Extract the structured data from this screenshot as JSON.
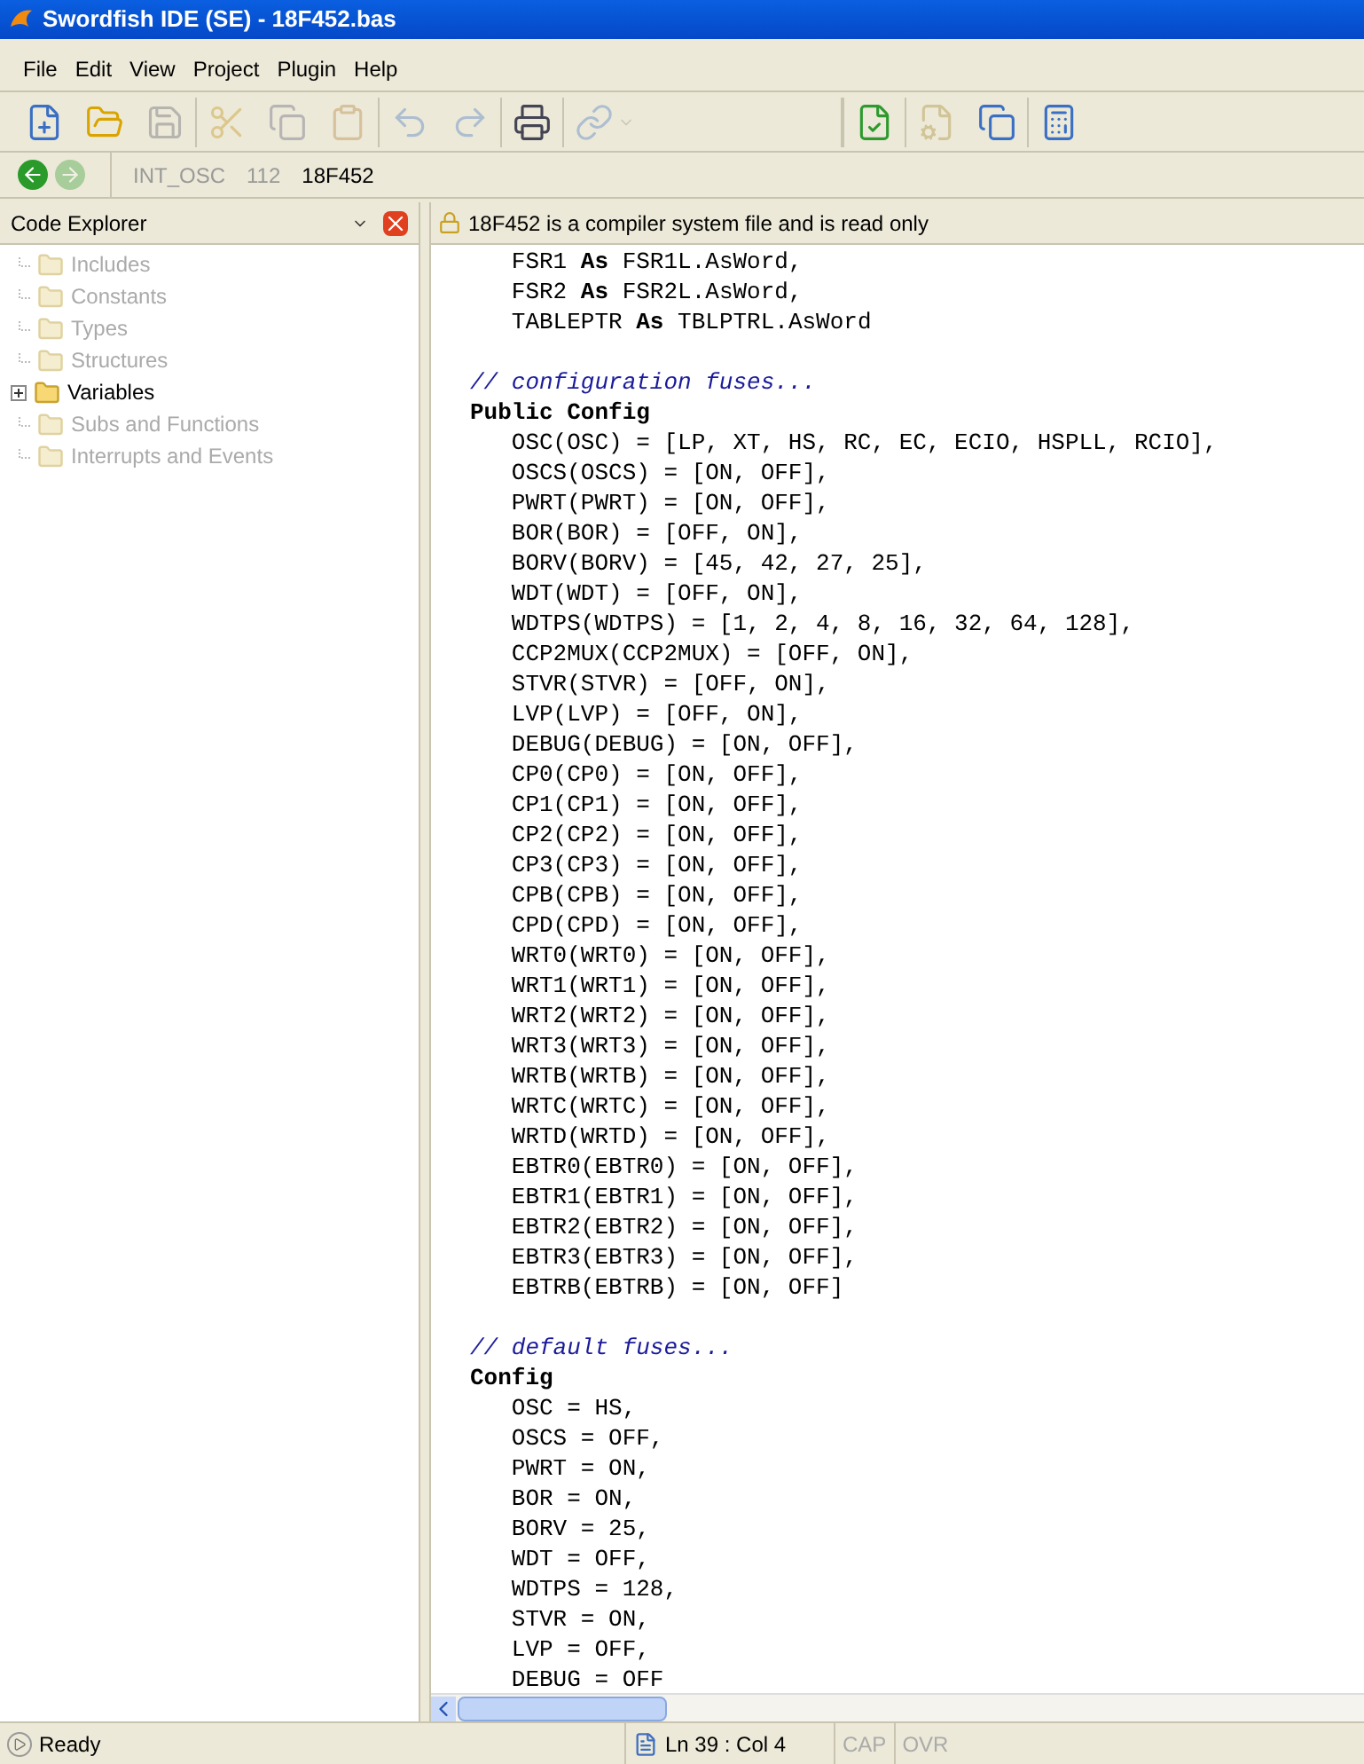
{
  "window": {
    "title": "Swordfish IDE (SE) - 18F452.bas"
  },
  "menu": [
    "File",
    "Edit",
    "View",
    "Project",
    "Plugin",
    "Help"
  ],
  "toolbar": [
    [
      {
        "kind": "new",
        "disabled": false
      },
      {
        "kind": "open",
        "disabled": false
      },
      {
        "kind": "save",
        "disabled": true
      }
    ],
    [
      {
        "kind": "cut",
        "disabled": true
      },
      {
        "kind": "copy",
        "disabled": true
      },
      {
        "kind": "paste",
        "disabled": true
      }
    ],
    [
      {
        "kind": "undo",
        "disabled": true
      },
      {
        "kind": "redo",
        "disabled": true
      }
    ],
    [
      {
        "kind": "print",
        "disabled": false
      }
    ],
    [
      {
        "kind": "link",
        "disabled": true
      }
    ],
    [
      {
        "kind": "compile",
        "disabled": false
      }
    ],
    [
      {
        "kind": "program",
        "disabled": true
      },
      {
        "kind": "windows",
        "disabled": false
      }
    ],
    [
      {
        "kind": "calculator",
        "disabled": false
      }
    ]
  ],
  "navigation": {
    "back_disabled": false,
    "forward_disabled": true,
    "crumbs": [
      {
        "text": "INT_OSC",
        "disabled": true
      },
      {
        "text": "112",
        "disabled": true
      },
      {
        "text": "18F452",
        "disabled": false
      }
    ]
  },
  "code_explorer": {
    "title": "Code Explorer",
    "items": [
      {
        "label": "Includes",
        "disabled": true,
        "expandable": false
      },
      {
        "label": "Constants",
        "disabled": true,
        "expandable": false
      },
      {
        "label": "Types",
        "disabled": true,
        "expandable": false
      },
      {
        "label": "Structures",
        "disabled": true,
        "expandable": false
      },
      {
        "label": "Variables",
        "disabled": false,
        "expandable": true
      },
      {
        "label": "Subs and Functions",
        "disabled": true,
        "expandable": false
      },
      {
        "label": "Interrupts and Events",
        "disabled": true,
        "expandable": false
      }
    ]
  },
  "editor": {
    "notice": "18F452 is a compiler system file and is read only",
    "blocks": [
      {
        "lines": [
          [
            {
              "kind": "plain",
              "text": "   FSR1 "
            },
            {
              "kind": "keyword",
              "text": "As"
            },
            {
              "kind": "plain",
              "text": " FSR1L.AsWord,"
            }
          ],
          [
            {
              "kind": "plain",
              "text": "   FSR2 "
            },
            {
              "kind": "keyword",
              "text": "As"
            },
            {
              "kind": "plain",
              "text": " FSR2L.AsWord,"
            }
          ],
          [
            {
              "kind": "plain",
              "text": "   TABLEPTR "
            },
            {
              "kind": "keyword",
              "text": "As"
            },
            {
              "kind": "plain",
              "text": " TBLPTRL.AsWord"
            }
          ]
        ]
      },
      {
        "lines": [
          [
            {
              "kind": "comment",
              "text": "// configuration fuses..."
            }
          ],
          [
            {
              "kind": "keyword",
              "text": "Public Config"
            }
          ],
          [
            {
              "kind": "plain",
              "text": "   OSC(OSC) = [LP, XT, HS, RC, EC, ECIO, HSPLL, RCIO],"
            }
          ],
          [
            {
              "kind": "plain",
              "text": "   OSCS(OSCS) = [ON, OFF],"
            }
          ],
          [
            {
              "kind": "plain",
              "text": "   PWRT(PWRT) = [ON, OFF],"
            }
          ],
          [
            {
              "kind": "plain",
              "text": "   BOR(BOR) = [OFF, ON],"
            }
          ],
          [
            {
              "kind": "plain",
              "text": "   BORV(BORV) = [45, 42, 27, 25],"
            }
          ],
          [
            {
              "kind": "plain",
              "text": "   WDT(WDT) = [OFF, ON],"
            }
          ],
          [
            {
              "kind": "plain",
              "text": "   WDTPS(WDTPS) = [1, 2, 4, 8, 16, 32, 64, 128],"
            }
          ],
          [
            {
              "kind": "plain",
              "text": "   CCP2MUX(CCP2MUX) = [OFF, ON],"
            }
          ],
          [
            {
              "kind": "plain",
              "text": "   STVR(STVR) = [OFF, ON],"
            }
          ],
          [
            {
              "kind": "plain",
              "text": "   LVP(LVP) = [OFF, ON],"
            }
          ],
          [
            {
              "kind": "plain",
              "text": "   DEBUG(DEBUG) = [ON, OFF],"
            }
          ],
          [
            {
              "kind": "plain",
              "text": "   CP0(CP0) = [ON, OFF],"
            }
          ],
          [
            {
              "kind": "plain",
              "text": "   CP1(CP1) = [ON, OFF],"
            }
          ],
          [
            {
              "kind": "plain",
              "text": "   CP2(CP2) = [ON, OFF],"
            }
          ],
          [
            {
              "kind": "plain",
              "text": "   CP3(CP3) = [ON, OFF],"
            }
          ],
          [
            {
              "kind": "plain",
              "text": "   CPB(CPB) = [ON, OFF],"
            }
          ],
          [
            {
              "kind": "plain",
              "text": "   CPD(CPD) = [ON, OFF],"
            }
          ],
          [
            {
              "kind": "plain",
              "text": "   WRT0(WRT0) = [ON, OFF],"
            }
          ],
          [
            {
              "kind": "plain",
              "text": "   WRT1(WRT1) = [ON, OFF],"
            }
          ],
          [
            {
              "kind": "plain",
              "text": "   WRT2(WRT2) = [ON, OFF],"
            }
          ],
          [
            {
              "kind": "plain",
              "text": "   WRT3(WRT3) = [ON, OFF],"
            }
          ],
          [
            {
              "kind": "plain",
              "text": "   WRTB(WRTB) = [ON, OFF],"
            }
          ],
          [
            {
              "kind": "plain",
              "text": "   WRTC(WRTC) = [ON, OFF],"
            }
          ],
          [
            {
              "kind": "plain",
              "text": "   WRTD(WRTD) = [ON, OFF],"
            }
          ],
          [
            {
              "kind": "plain",
              "text": "   EBTR0(EBTR0) = [ON, OFF],"
            }
          ],
          [
            {
              "kind": "plain",
              "text": "   EBTR1(EBTR1) = [ON, OFF],"
            }
          ],
          [
            {
              "kind": "plain",
              "text": "   EBTR2(EBTR2) = [ON, OFF],"
            }
          ],
          [
            {
              "kind": "plain",
              "text": "   EBTR3(EBTR3) = [ON, OFF],"
            }
          ],
          [
            {
              "kind": "plain",
              "text": "   EBTRB(EBTRB) = [ON, OFF]"
            }
          ]
        ]
      },
      {
        "lines": [
          [
            {
              "kind": "comment",
              "text": "// default fuses..."
            }
          ],
          [
            {
              "kind": "keyword",
              "text": "Config"
            }
          ],
          [
            {
              "kind": "plain",
              "text": "   OSC = HS,"
            }
          ],
          [
            {
              "kind": "plain",
              "text": "   OSCS = OFF,"
            }
          ],
          [
            {
              "kind": "plain",
              "text": "   PWRT = ON,"
            }
          ],
          [
            {
              "kind": "plain",
              "text": "   BOR = ON,"
            }
          ],
          [
            {
              "kind": "plain",
              "text": "   BORV = 25,"
            }
          ],
          [
            {
              "kind": "plain",
              "text": "   WDT = OFF,"
            }
          ],
          [
            {
              "kind": "plain",
              "text": "   WDTPS = 128,"
            }
          ],
          [
            {
              "kind": "plain",
              "text": "   STVR = ON,"
            }
          ],
          [
            {
              "kind": "plain",
              "text": "   LVP = OFF,"
            }
          ],
          [
            {
              "kind": "plain",
              "text": "   DEBUG = OFF"
            }
          ]
        ]
      }
    ]
  },
  "status_bar": {
    "message": "Ready",
    "position": "Ln 39 : Col 4",
    "indicators": [
      {
        "text": "CAP",
        "disabled": true
      },
      {
        "text": "OVR",
        "disabled": true
      }
    ]
  }
}
